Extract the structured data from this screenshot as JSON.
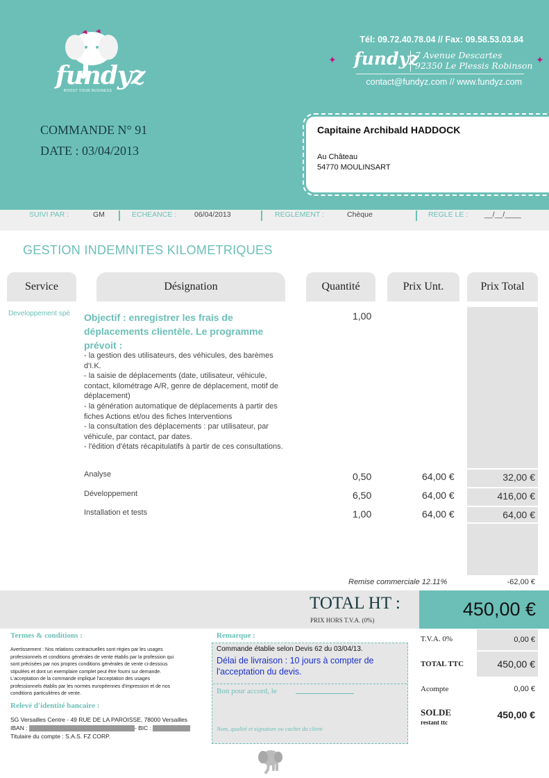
{
  "header": {
    "logo_text": "fundyz",
    "logo_tagline": "BOOST YOUR BUSINESS",
    "contact_tel": "Tél: 09.72.40.78.04 // Fax: 09.58.53.03.84",
    "brand": "fundyz",
    "address_line1": "7 Avenue Descartes",
    "address_line2": "92350 Le Plessis Robinson",
    "web": "contact@fundyz.com // www.fundyz.com",
    "accent_color": "#6bbfb7",
    "bird_color": "#c2187c"
  },
  "order": {
    "number": "COMMANDE N° 91",
    "date": "DATE : 03/04/2013"
  },
  "client": {
    "name": "Capitaine Archibald HADDOCK",
    "address1": "Au Château",
    "address2": "54770 MOULINSART"
  },
  "strip": {
    "suivi_label": "SUIVI PAR :",
    "suivi_value": "GM",
    "echeance_label": "ECHEANCE :",
    "echeance_value": "06/04/2013",
    "reglement_label": "REGLEMENT :",
    "reglement_value": "Chèque",
    "regle_label": "REGLE LE :",
    "regle_value": "__/__/____"
  },
  "section_title": "GESTION INDEMNITES KILOMETRIQUES",
  "table": {
    "headers": [
      "Service",
      "Désignation",
      "Quantité",
      "Prix Unt.",
      "Prix Total"
    ],
    "service": "Developpement spé",
    "designation_title": "Objectif : enregistrer les frais de déplacements clientèle.  Le programme prévoit :",
    "designation_lines": [
      "- la gestion des utilisateurs, des véhicules, des barèmes d'I.K.",
      "- la saisie de déplacements (date, utilisateur, véhicule, contact, kilométrage A/R, genre de déplacement, motif de déplacement)",
      "- la génération automatique de déplacements à partir des fiches Actions et/ou des fiches Interventions",
      "- la consultation des déplacements : par utilisateur, par véhicule, par contact, par dates.",
      "- l'édition d'états récapitulatifs à partir de ces consultations."
    ],
    "main_quantity": "1,00",
    "rows": [
      {
        "label": "Analyse",
        "qty": "0,50",
        "price": "64,00 €",
        "total": "32,00 €"
      },
      {
        "label": "Développement",
        "qty": "6,50",
        "price": "64,00 €",
        "total": "416,00 €"
      },
      {
        "label": "Installation et tests",
        "qty": "1,00",
        "price": "64,00 €",
        "total": "64,00 €"
      }
    ],
    "discount_label": "Remise commerciale 12.11%",
    "discount_value": "-62,00 €"
  },
  "totals": {
    "total_ht_label": "TOTAL HT :",
    "total_ht_sub": "PRIX HORS T.V.A. (0%)",
    "total_ht_value": "450,00 €",
    "tva_label": "T.V.A. 0%",
    "tva_value": "0,00 €",
    "ttc_label": "TOTAL TTC",
    "ttc_value": "450,00 €",
    "acompte_label": "Acompte",
    "acompte_value": "0,00 €",
    "solde_label": "SOLDE",
    "solde_sub": "restant ttc",
    "solde_value": "450,00 €"
  },
  "terms": {
    "title": "Termes & conditions :",
    "lines": [
      "Avertissement : Nos relations contractuelles sont régies par les usages",
      "professionnels et conditions générales de vente établis par la profession qui",
      "sont précisées par nos propres conditions générales de vente ci-dessous",
      "stipulées et dont un exemplaire complet peut être fourni sur demande.",
      "L'acceptation de la commande implique l'acceptation des usages",
      "professionnels établis par les normes européennes d'impression et de nos",
      "conditions particulières de vente."
    ]
  },
  "bank": {
    "title": "Relevé d'identité bancaire :",
    "line1": "SG Versailles Centre - 49 RUE DE LA PAROISSE, 78000 Versailles",
    "iban_label": "IBAN :",
    "bic_label": "- BIC :",
    "holder": "Titulaire du compte : S.A.S. FZ CORP."
  },
  "remarque": {
    "title": "Remarque :",
    "head": "Commande établie selon Devis 62 du 03/04/13.",
    "blue": "Délai de livraison : 10 jours à compter de l'acceptation du devis.",
    "ok": "Bon pour accord, le",
    "sign": "Nom, qualité et signature ou cachet du client"
  }
}
